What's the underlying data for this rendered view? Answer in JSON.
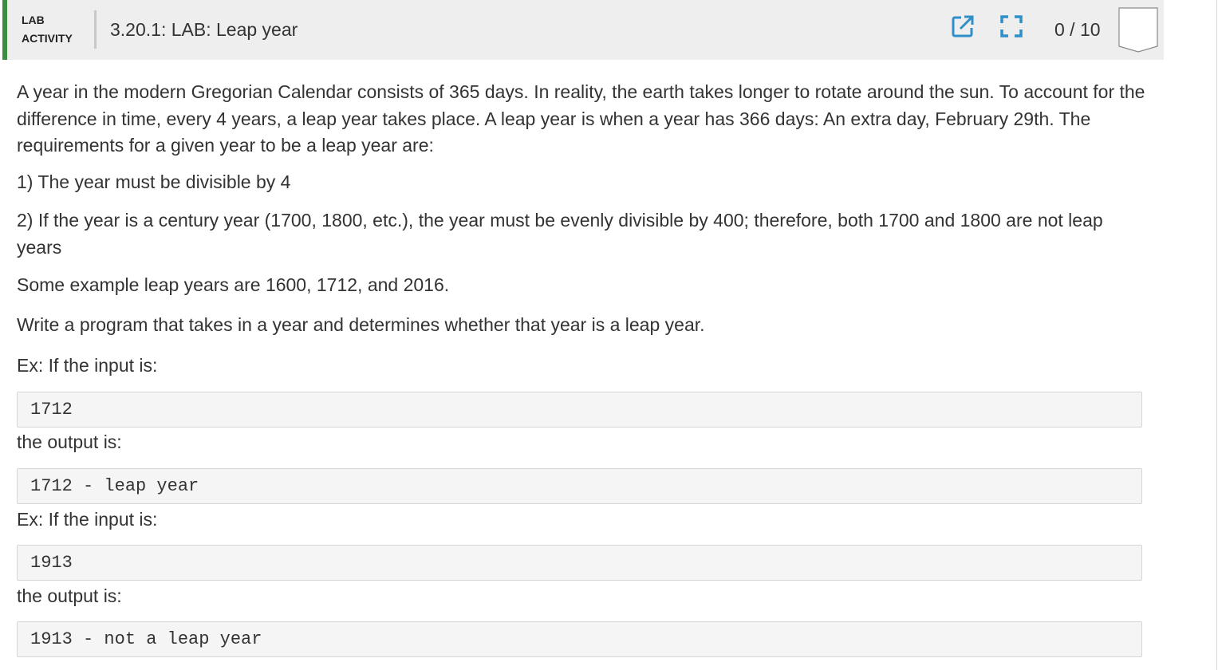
{
  "header": {
    "activity_type_line1": "LAB",
    "activity_type_line2": "ACTIVITY",
    "title": "3.20.1: LAB: Leap year",
    "score": "0 / 10",
    "accent_color": "#3d8c40",
    "icon_color": "#2f8fc8",
    "icons": [
      "open-in-new-window-icon",
      "fullscreen-icon"
    ]
  },
  "instructions": {
    "intro": "A year in the modern Gregorian Calendar consists of 365 days. In reality, the earth takes longer to rotate around the sun. To account for the difference in time, every 4 years, a leap year takes place. A leap year is when a year has 366 days: An extra day, February 29th. The requirements for a given year to be a leap year are:",
    "requirement_1": "1) The year must be divisible by 4",
    "requirement_2": "2) If the year is a century year (1700, 1800, etc.), the year must be evenly divisible by 400; therefore, both 1700 and 1800 are not leap years",
    "examples_note": "Some example leap years are 1600, 1712, and 2016.",
    "task": "Write a program that takes in a year and determines whether that year is a leap year."
  },
  "examples": [
    {
      "input_label": "Ex: If the input is:",
      "input": "1712",
      "output_label": "the output is:",
      "output": "1712 - leap year"
    },
    {
      "input_label": "Ex: If the input is:",
      "input": "1913",
      "output_label": "the output is:",
      "output": "1913 - not a leap year"
    }
  ]
}
